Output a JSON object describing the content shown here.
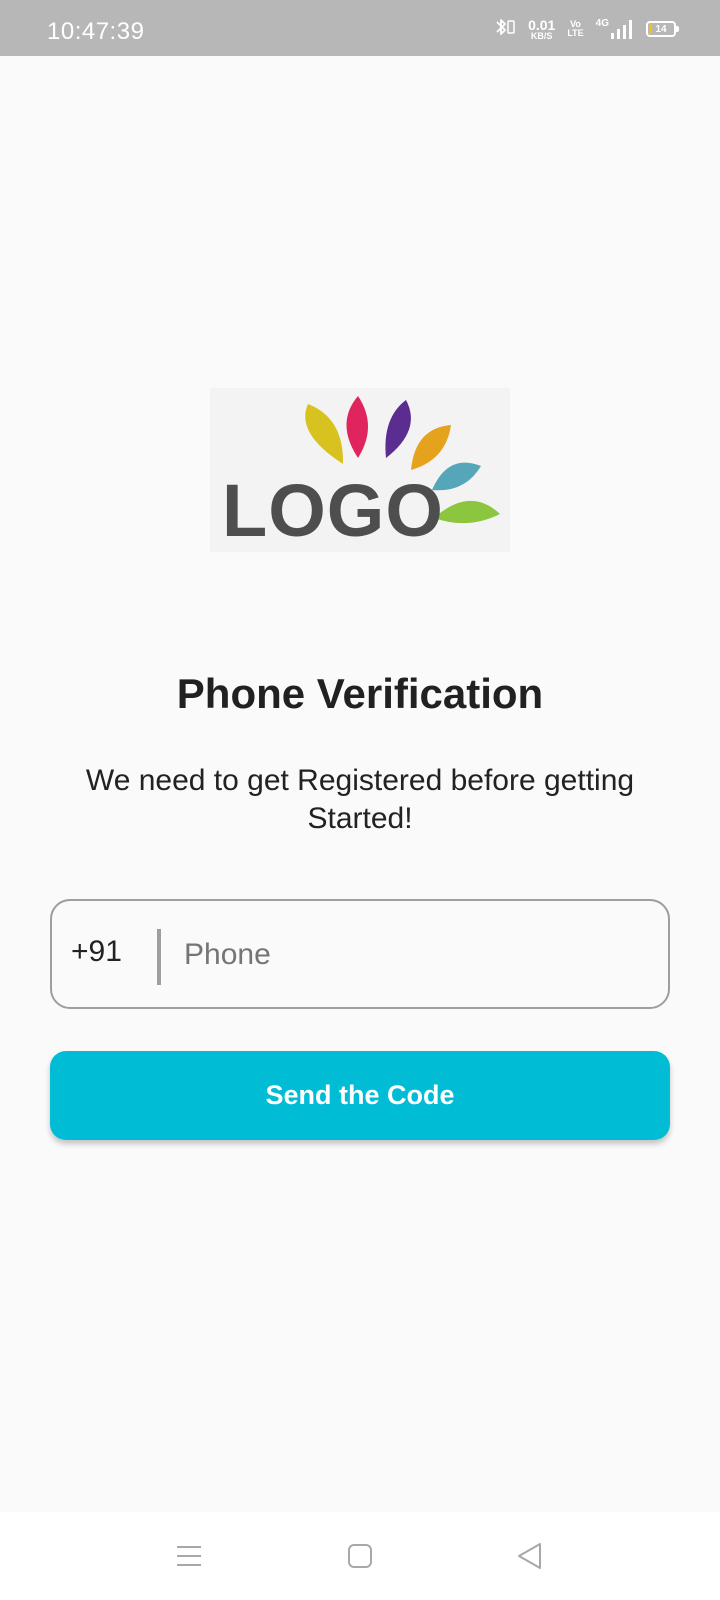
{
  "status_bar": {
    "time": "10:47:39",
    "net_speed_value": "0.01",
    "net_speed_unit": "KB/S",
    "volte_top": "Vo",
    "volte_bottom": "LTE",
    "network_type": "4G",
    "battery_level": "14",
    "battery_fraction": 0.14,
    "icons": [
      "bluetooth-icon",
      "signal-icon",
      "battery-icon"
    ]
  },
  "logo": {
    "text": "LOGO",
    "petal_colors": [
      "#d7c21f",
      "#e0245e",
      "#5b2d90",
      "#e5a21c",
      "#54a6b8",
      "#8cc63f"
    ]
  },
  "main": {
    "title": "Phone Verification",
    "subtitle": "We need to get Registered before getting Started!",
    "country_code": "+91",
    "phone_placeholder": "Phone",
    "phone_value": "",
    "send_button_label": "Send the Code"
  },
  "colors": {
    "accent": "#00bcd4",
    "status_bar": "#b7b7b7",
    "background": "#fafafa"
  },
  "nav_bar": {
    "icons": [
      "menu-icon",
      "home-icon",
      "back-icon"
    ]
  }
}
